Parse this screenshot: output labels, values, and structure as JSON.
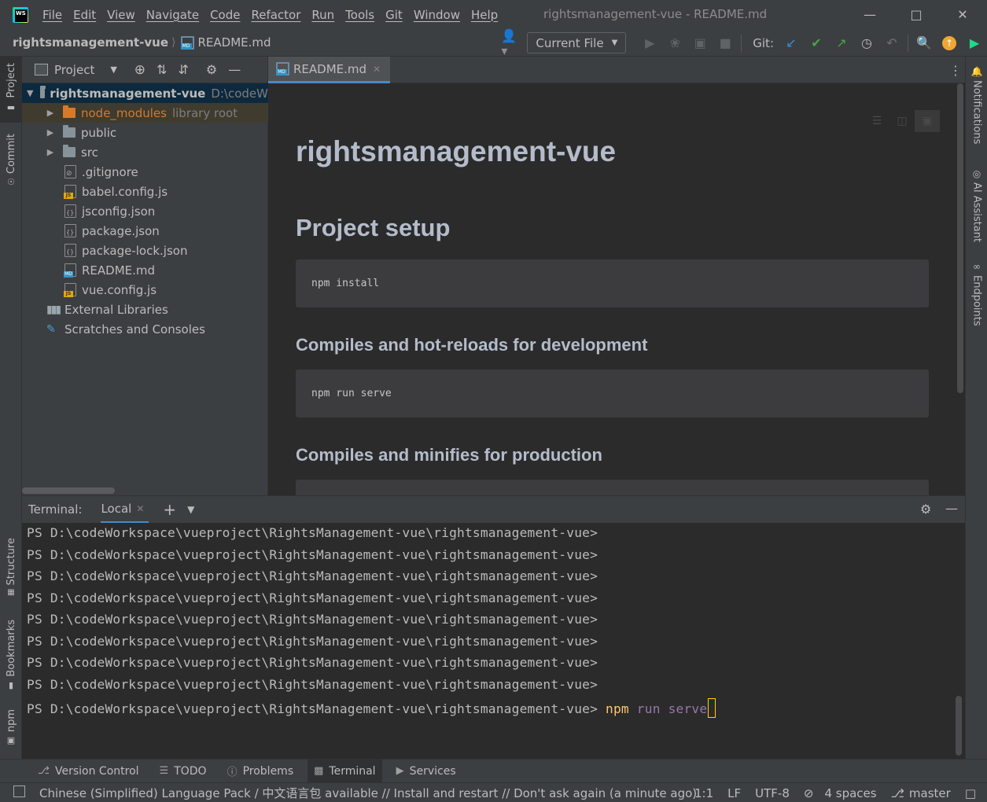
{
  "window": {
    "menu": [
      "File",
      "Edit",
      "View",
      "Navigate",
      "Code",
      "Refactor",
      "Run",
      "Tools",
      "Git",
      "Window",
      "Help"
    ],
    "title": "rightsmanagement-vue - README.md"
  },
  "navbar": {
    "project": "rightsmanagement-vue",
    "file": "README.md",
    "run_config": "Current File",
    "git_label": "Git:"
  },
  "left_strip": {
    "project": "Project",
    "commit": "Commit",
    "structure": "Structure",
    "bookmarks": "Bookmarks",
    "npm": "npm"
  },
  "right_strip": {
    "notifications": "Notifications",
    "ai_assistant": "AI Assistant",
    "endpoints": "Endpoints"
  },
  "project_panel": {
    "title": "Project",
    "tree": [
      {
        "name": "rightsmanagement-vue",
        "hint": "D:\\codeW"
      },
      {
        "name": "node_modules",
        "hint": "library root"
      },
      {
        "name": "public"
      },
      {
        "name": "src"
      },
      {
        "name": ".gitignore"
      },
      {
        "name": "babel.config.js"
      },
      {
        "name": "jsconfig.json"
      },
      {
        "name": "package.json"
      },
      {
        "name": "package-lock.json"
      },
      {
        "name": "README.md"
      },
      {
        "name": "vue.config.js"
      },
      {
        "name": "External Libraries"
      },
      {
        "name": "Scratches and Consoles"
      }
    ]
  },
  "editor": {
    "tab": "README.md",
    "h1": "rightsmanagement-vue",
    "sections": [
      {
        "heading": "Project setup",
        "code": "npm install"
      },
      {
        "heading": "Compiles and hot-reloads for development",
        "code": "npm run serve"
      },
      {
        "heading": "Compiles and minifies for production",
        "code": ""
      }
    ]
  },
  "terminal": {
    "title": "Terminal:",
    "tab": "Local",
    "prompt": "PS D:\\codeWorkspace\\vueproject\\RightsManagement-vue\\rightsmanagement-vue>",
    "input_cmd": "npm",
    "input_args": "run serve"
  },
  "bottom_tabs": [
    "Version Control",
    "TODO",
    "Problems",
    "Terminal",
    "Services"
  ],
  "statusbar": {
    "message": "Chinese (Simplified) Language Pack / 中文语言包 available // Install and restart // Don't ask again (a minute ago)",
    "position": "1:1",
    "line_sep": "LF",
    "encoding": "UTF-8",
    "indent": "4 spaces",
    "branch": "master"
  },
  "colors": {
    "accent": "#4a88c7",
    "cursor": "#ffd400",
    "command": "#ffc66d",
    "library": "#d6792a"
  }
}
